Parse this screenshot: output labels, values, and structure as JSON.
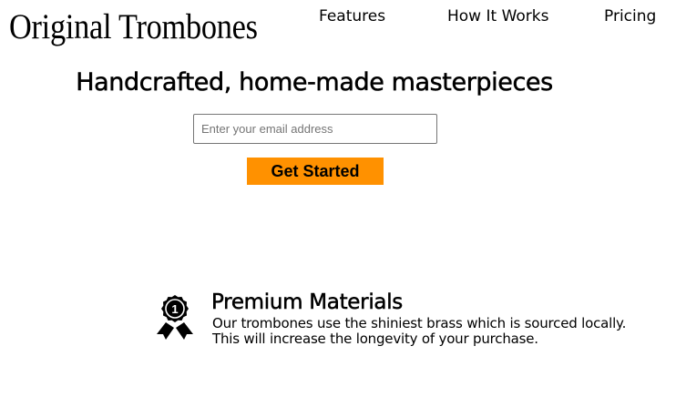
{
  "header": {
    "logo": "Original Trombones",
    "nav": {
      "features": "Features",
      "how_it_works": "How It Works",
      "pricing": "Pricing"
    }
  },
  "hero": {
    "headline": "Handcrafted, home-made masterpieces",
    "email_placeholder": "Enter your email address",
    "cta_label": "Get Started",
    "cta_color": "#ff9100"
  },
  "features": [
    {
      "icon": "medal-icon",
      "badge_number": "1",
      "title": "Premium Materials",
      "description": "Our trombones use the shiniest brass which is sourced locally. This will increase the longevity of your purchase."
    }
  ]
}
